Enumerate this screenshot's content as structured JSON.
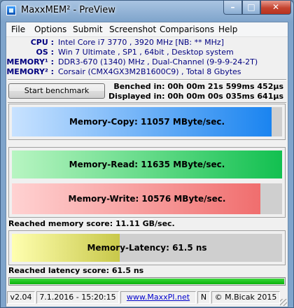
{
  "window": {
    "title": "MaxxMEM² - PreView"
  },
  "menu": [
    "File",
    "Options",
    "Submit",
    "Screenshot",
    "Comparisons",
    "Help"
  ],
  "info": [
    {
      "label": "CPU :",
      "value": "Intel Core i7 3770 , 3920 MHz  [NB: ** MHz]"
    },
    {
      "label": "OS :",
      "value": "Win 7 Ultimate , SP1 , 64bit , Desktop system"
    },
    {
      "label": "MEMORY¹ :",
      "value": "DDR3-670 (1340) MHz , Dual-Channel (9-9-9-24-2T)"
    },
    {
      "label": "MEMORY² :",
      "value": "Corsair (CMX4GX3M2B1600C9) , Total 8 Gbytes"
    }
  ],
  "benchmark_button": "Start benchmark",
  "benched": "Benched in: 00h 00m 21s 599ms 452µs",
  "displayed": "Displayed in: 00h 00m 00s 035ms 641µs",
  "bars": {
    "copy": {
      "label": "Memory-Copy: 11057 MByte/sec.",
      "level": 0.96,
      "color_start": "#c8e2ff",
      "color_end": "#1a84f0"
    },
    "read": {
      "label": "Memory-Read: 11635 MByte/sec.",
      "level": 1.0,
      "color_start": "#b8f5c2",
      "color_end": "#12c050"
    },
    "write": {
      "label": "Memory-Write: 10576 MByte/sec.",
      "level": 0.92,
      "color_start": "#ffd2d2",
      "color_end": "#f06e6e"
    },
    "latency": {
      "label": "Memory-Latency: 61.5 ns",
      "level": 0.4,
      "color_start": "#ffffb0",
      "color_end": "#c8c84a"
    }
  },
  "memory_score": "Reached memory score: 11.11 GB/sec.",
  "latency_score": "Reached latency score: 61.5 ns",
  "progress": {
    "level": 1.0
  },
  "status": {
    "version": "v2.04",
    "date": "7.1.2016 - 15:20:15",
    "link": "www.MaxxPI.net",
    "flag": "N",
    "copyright": "© M.Bicak 2015"
  }
}
